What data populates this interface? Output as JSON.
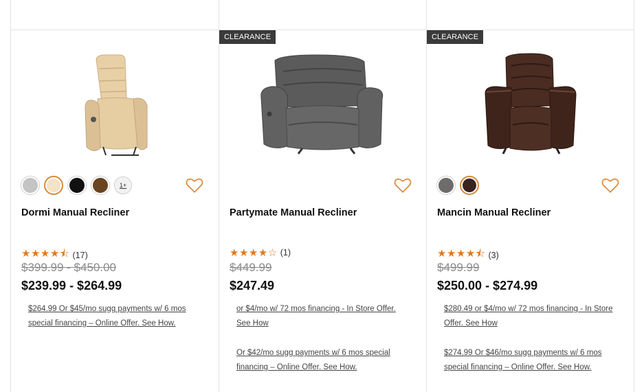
{
  "products": [
    {
      "name": "Dormi Manual Recliner",
      "badge": "",
      "rating": {
        "stars": "★★★★⯪",
        "count": "(17)"
      },
      "original_price": "$399.99 - $450.00",
      "price": "$239.99 - $264.99",
      "financing": [
        "$264.99 Or $45/mo sugg payments w/ 6 mos special financing – Online Offer. See How."
      ],
      "swatches": [
        "#c4c4c4",
        "#f4e3c4",
        "#111111",
        "#6a4420"
      ],
      "selected_swatch": 1,
      "more_swatches": "1+",
      "image": "beige-recliner"
    },
    {
      "name": "Partymate Manual Recliner",
      "badge": "CLEARANCE",
      "rating": {
        "stars": "★★★★☆",
        "count": "(1)"
      },
      "original_price": "$449.99",
      "price": "$247.49",
      "financing": [
        "or $4/mo w/ 72 mos financing - In Store Offer. See How",
        "Or $42/mo sugg payments w/ 6 mos special financing – Online Offer. See How."
      ],
      "swatches": [],
      "image": "gray-recliner"
    },
    {
      "name": "Mancin Manual Recliner",
      "badge": "CLEARANCE",
      "rating": {
        "stars": "★★★★⯪",
        "count": "(3)"
      },
      "original_price": "$499.99",
      "price": "$250.00 - $274.99",
      "financing": [
        "$280.49 or $4/mo w/ 72 mos financing - In Store Offer. See How",
        "$274.99 Or $46/mo sugg payments w/ 6 mos special financing – Online Offer. See How."
      ],
      "swatches": [
        "#6e6c6a",
        "#3a2420"
      ],
      "selected_swatch": 1,
      "image": "brown-recliner"
    }
  ],
  "colors": {
    "accent": "#e07a1f",
    "heart": "#e08a3c",
    "badge_bg": "#3a3a3a"
  },
  "icons": {
    "wishlist": "heart-outline-icon"
  }
}
